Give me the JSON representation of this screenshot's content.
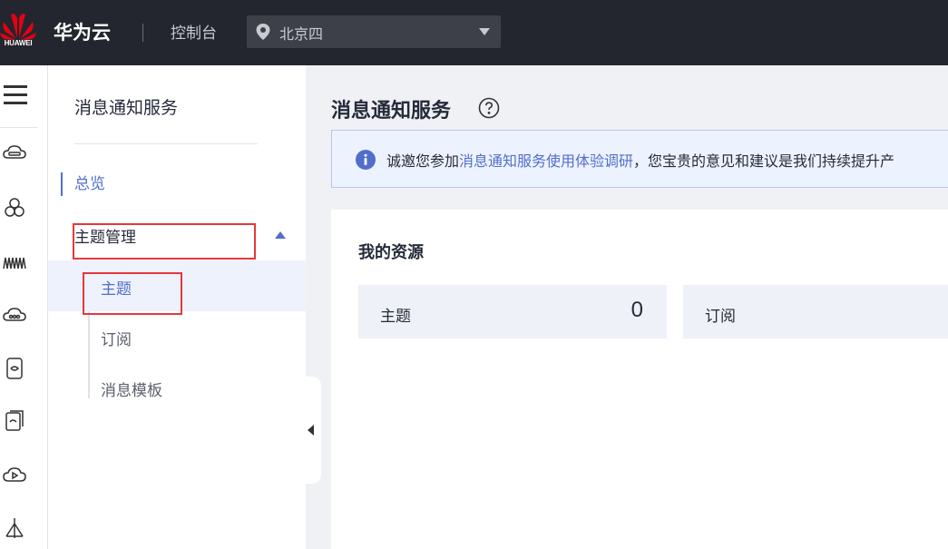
{
  "topbar": {
    "logo_text": "HUAWEI",
    "brand": "华为云",
    "console": "控制台",
    "region": "北京四",
    "colors": {
      "background": "#23262e",
      "logo_red": "#e60012"
    }
  },
  "rail": {
    "icons": [
      "menu-icon",
      "cloud-server-icon",
      "hexagon-cluster-icon",
      "waveform-icon",
      "cloud-database-icon",
      "storage-icon",
      "backup-icon",
      "cloud-play-icon",
      "network-icon"
    ]
  },
  "sidenav": {
    "title": "消息通知服务",
    "overview": "总览",
    "group": "主题管理",
    "items": [
      {
        "label": "主题",
        "active": true
      },
      {
        "label": "订阅",
        "active": false
      },
      {
        "label": "消息模板",
        "active": false
      }
    ],
    "accent": "#526ecc",
    "highlight_color": "#e5383b"
  },
  "main": {
    "title": "消息通知服务",
    "notice": {
      "prefix": "诚邀您参加",
      "link": "消息通知服务使用体验调研",
      "suffix": "，您宝贵的意见和建议是我们持续提升产"
    },
    "resources": {
      "title": "我的资源",
      "cards": [
        {
          "label": "主题",
          "value": "0"
        },
        {
          "label": "订阅",
          "value": ""
        }
      ]
    }
  }
}
